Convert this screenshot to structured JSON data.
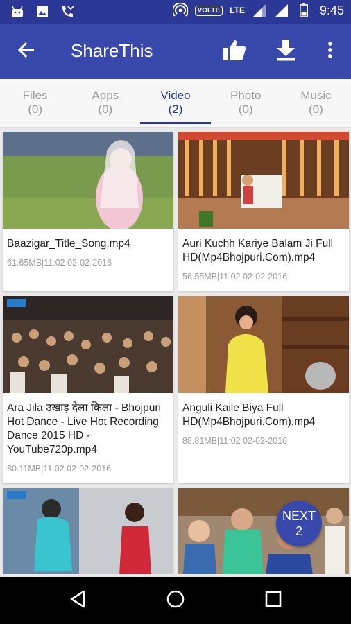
{
  "status_bar": {
    "volte": "VOLTE",
    "network": "LTE",
    "time": "9:45",
    "icons": [
      "android-icon",
      "image-icon",
      "missed-call-icon",
      "hotspot-icon",
      "signal-icon",
      "battery-icon"
    ]
  },
  "app_bar": {
    "title": "ShareThis",
    "back_icon": "arrow-left-icon",
    "like_icon": "thumbs-up-icon",
    "download_icon": "download-icon",
    "more_icon": "more-vertical-icon",
    "background": "#3949ab"
  },
  "tabs": [
    {
      "label": "Files",
      "count": "(0)"
    },
    {
      "label": "Apps",
      "count": "(0)"
    },
    {
      "label": "Video",
      "count": "(2)"
    },
    {
      "label": "Photo",
      "count": "(0)"
    },
    {
      "label": "Music",
      "count": "(0)"
    }
  ],
  "videos": [
    {
      "title": "Baazigar_Title_Song.mp4",
      "meta": "61.65MB|11:02 02-02-2016"
    },
    {
      "title": "Auri Kuchh Kariye Balam Ji Full HD(Mp4Bhojpuri.Com).mp4",
      "meta": "56.55MB|11:02 02-02-2016"
    },
    {
      "title": "Ara Jila उखाड़ देला किला - Bhojpuri Hot Dance - Live Hot Recording Dance 2015 HD - YouTube720p.mp4",
      "meta": "80.11MB|11:02 02-02-2016"
    },
    {
      "title": "Anguli Kaile Biya Full HD(Mp4Bhojpuri.Com).mp4",
      "meta": "88.81MB|11:02 02-02-2016"
    },
    {
      "title": "",
      "meta": ""
    },
    {
      "title": "",
      "meta": ""
    }
  ],
  "fab": {
    "line1": "NEXT",
    "line2": "2"
  },
  "nav_bar": {
    "icons": [
      "back-triangle-icon",
      "home-circle-icon",
      "recents-square-icon"
    ]
  }
}
